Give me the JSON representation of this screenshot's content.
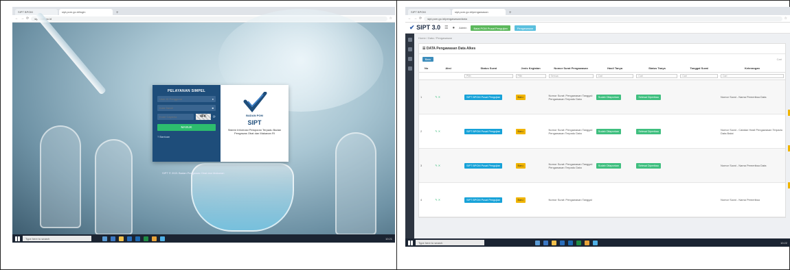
{
  "left": {
    "browser": {
      "tabs": [
        "SIPT BPOM",
        "sipt.pom.go.id/login"
      ],
      "new_tab": "+",
      "url": "sipt.pom.go.id"
    },
    "login": {
      "brand": "PELAYANAN SIMPEL",
      "username_placeholder": "User ID Pengguna",
      "password_placeholder": "Kata Sandi",
      "captcha_placeholder": "Kode Captcha",
      "captcha_value": "4FK",
      "login_button": "MASUK",
      "help_link": "Bantuan",
      "agency": "BADAN POM",
      "app_name": "SIPT",
      "app_desc": "Sistem Informasi Pelaporan Terpadu Badan Pengawas Obat dan Makanan RI",
      "footer": "SIPT © 2021 Badan Pengawas Obat dan Makanan"
    },
    "taskbar": {
      "search": "Type here to search",
      "clock": "10:21"
    }
  },
  "right": {
    "browser": {
      "tabs": [
        "SIPT BPOM",
        "sipt.pom.go.id/pengawasan"
      ],
      "new_tab": "+",
      "url": "sipt.pom.go.id/pengawasan/data"
    },
    "header": {
      "logo_main": "SIPT",
      "logo_version": "3.0",
      "user": "Admin",
      "badge_green": "Balai POM Pusat Pengujian",
      "badge_blue": "Pengawasan"
    },
    "breadcrumb": "Home / Data / Pengawasan",
    "panel_title": "DATA Pengawasan Data Alkes",
    "add_button": "Baru",
    "table_search": "Cari",
    "columns": [
      "No",
      "Aksi",
      "Status Surat",
      "Jenis Kegiatan",
      "Nomor Surat Pengawasan",
      "Hasil Tanya",
      "Status Tanya",
      "Tanggal Surat",
      "Keterangan"
    ],
    "filters": [
      "Pilih",
      "Pilih",
      "Semua",
      "Cari",
      "Cari",
      "Cari",
      "Cari"
    ],
    "rows": [
      {
        "no": "1",
        "status": "SIPT BPOM Pusat Pengujian",
        "type": "Baru",
        "detail": "Nomor Surat: Pengawasan Tanggal: Pengawasan Terpadu Data",
        "result": "Sudah Dilaporkan",
        "state": "Selesai Diperiksa",
        "note": "Nomor Surat - Nama Pemeriksa Data"
      },
      {
        "no": "2",
        "status": "SIPT BPOM Pusat Pengujian",
        "type": "Baru",
        "detail": "Nomor Surat: Pengawasan Tanggal: Pengawasan Terpadu Data",
        "result": "Sudah Dilaporkan",
        "state": "Selesai Diperiksa",
        "note": "Nomor Surat - Catatan Hasil Pengawasan Terpadu Data Balai"
      },
      {
        "no": "3",
        "status": "SIPT BPOM Pusat Pengujian",
        "type": "Baru",
        "detail": "Nomor Surat: Pengawasan Tanggal: Pengawasan Terpadu Data",
        "result": "Sudah Dilaporkan",
        "state": "Selesai Diperiksa",
        "note": "Nomor Surat - Nama Pemeriksa Data"
      },
      {
        "no": "4",
        "status": "SIPT BPOM Pusat Pengujian",
        "type": "Baru",
        "detail": "Nomor Surat: Pengawasan Tanggal",
        "result": "",
        "state": "",
        "note": "Nomor Surat - Nama Pemeriksa"
      }
    ],
    "taskbar": {
      "search": "Type here to search",
      "clock": "10:22"
    }
  },
  "colors": {
    "login_panel": "#1e4d7a",
    "login_button": "#2dbd6e",
    "chip_blue": "#17a2d8",
    "chip_yellow": "#f0b400",
    "chip_green": "#3fbf7f",
    "sidebar": "#2d3541",
    "taskbar": "#1b2432"
  }
}
